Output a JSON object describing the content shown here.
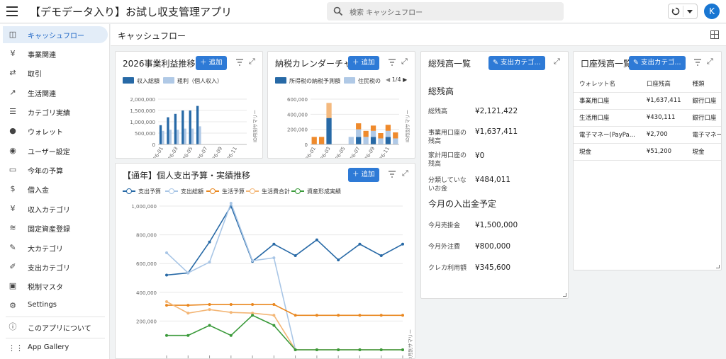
{
  "app": {
    "title": "【デモデータ入り】お試し収支管理アプリ",
    "search_placeholder": "検索 キャッシュフロー",
    "avatar_letter": "K",
    "accent": "#2e7ad6"
  },
  "sidebar": {
    "items": [
      {
        "label": "キャッシュフロー",
        "icon": "dashboard-icon",
        "active": true
      },
      {
        "label": "事業関連",
        "icon": "yen-icon"
      },
      {
        "label": "取引",
        "icon": "transfer-icon"
      },
      {
        "label": "生活関連",
        "icon": "trend-icon"
      },
      {
        "label": "カテゴリ実績",
        "icon": "list-icon"
      },
      {
        "label": "ウォレット",
        "icon": "piggy-bank-icon"
      },
      {
        "label": "ユーザー設定",
        "icon": "user-icon"
      },
      {
        "label": "今年の予算",
        "icon": "budget-icon"
      },
      {
        "label": "借入金",
        "icon": "money-bag-icon"
      },
      {
        "label": "収入カテゴリ",
        "icon": "yen-icon"
      },
      {
        "label": "固定資産登録",
        "icon": "coins-icon"
      },
      {
        "label": "大カテゴリ",
        "icon": "pen-icon"
      },
      {
        "label": "支出カテゴリ",
        "icon": "pen-outline-icon"
      },
      {
        "label": "税制マスタ",
        "icon": "banknote-icon"
      },
      {
        "label": "Settings",
        "icon": "gear-icon"
      },
      {
        "label": "このアプリについて",
        "icon": "info-icon"
      },
      {
        "label": "App Gallery",
        "icon": "apps-icon"
      }
    ]
  },
  "page": {
    "title": "キャッシュフロー"
  },
  "cards": {
    "profit": {
      "title": "2026事業利益推移予",
      "add": "追加",
      "legend": [
        "収入総額",
        "粗利（個人収入）"
      ],
      "side_label": "ID月別サマリー"
    },
    "tax": {
      "title": "納税カレンダーチャ",
      "add": "追加",
      "legend": [
        "所得税の納税予測額",
        "住民税の納"
      ],
      "pager": "1/4",
      "side_label": "ID月別サマリー"
    },
    "balance": {
      "title": "総残高一覧",
      "button": "支出カテゴ...",
      "section1": "総残高",
      "rows": [
        {
          "k": "総残高",
          "v": "¥2,121,422"
        },
        {
          "k": "事業用口座の残高",
          "v": "¥1,637,411"
        },
        {
          "k": "家計用口座の残高",
          "v": "¥0"
        },
        {
          "k": "分類していないお金",
          "v": "¥484,011"
        }
      ],
      "section2": "今月の入出金予定",
      "rows2": [
        {
          "k": "今月売掛金",
          "v": "¥1,500,000"
        },
        {
          "k": "今月外注費",
          "v": "¥800,000"
        },
        {
          "k": "クレカ利用額",
          "v": "¥345,600"
        }
      ]
    },
    "accounts": {
      "title": "口座残高一覧",
      "button": "支出カテゴ...",
      "columns": [
        "ウォレット名",
        "口座残高",
        "種類"
      ],
      "rows": [
        [
          "事業用口座",
          "¥1,637,411",
          "銀行口座"
        ],
        [
          "生活用口座",
          "¥430,111",
          "銀行口座"
        ],
        [
          "電子マネー(PayPa...",
          "¥2,700",
          "電子マネー"
        ],
        [
          "現金",
          "¥51,200",
          "現金"
        ]
      ]
    },
    "yearly": {
      "title": "【通年】個人支出予算・実績推移",
      "add": "追加",
      "side_label": "ID月別サマリー"
    }
  },
  "chart_data": [
    {
      "type": "bar",
      "title": "2026事業利益推移予",
      "categories": [
        "2026-01",
        "2026-02",
        "2026-03",
        "2026-04",
        "2026-05",
        "2026-06",
        "2026-07",
        "2026-08",
        "2026-09",
        "2026-10",
        "2026-11",
        "2026-12"
      ],
      "x_tick_labels": [
        "2026-01",
        "2026-03",
        "2026-05",
        "2026-07",
        "2026-09",
        "2026-11"
      ],
      "ylim": [
        0,
        2000000
      ],
      "y_ticks": [
        "0",
        "500,000",
        "1,000,000",
        "1,500,000",
        "2,000,000"
      ],
      "series": [
        {
          "name": "収入総額",
          "color": "#2769a6",
          "values": [
            850000,
            1200000,
            1350000,
            1500000,
            1500000,
            1700000,
            0,
            0,
            0,
            0,
            0,
            0
          ]
        },
        {
          "name": "粗利（個人収入）",
          "color": "#b0c9e6",
          "values": [
            600000,
            650000,
            650000,
            700000,
            700000,
            800000,
            0,
            0,
            0,
            0,
            0,
            0
          ]
        }
      ]
    },
    {
      "type": "bar",
      "title": "納税カレンダーチャ",
      "stacked": true,
      "categories": [
        "2026-01",
        "2026-02",
        "2026-03",
        "2026-04",
        "2026-05",
        "2026-06",
        "2026-07",
        "2026-08",
        "2026-09",
        "2026-10",
        "2026-11",
        "2026-12"
      ],
      "x_tick_labels": [
        "2026-01",
        "2026-03",
        "2026-05",
        "2026-07",
        "2026-09",
        "2026-11"
      ],
      "ylim": [
        0,
        600000
      ],
      "y_ticks": [
        "0",
        "200,000",
        "400,000",
        "600,000"
      ],
      "series": [
        {
          "name": "所得税の納税予測額",
          "color": "#2769a6",
          "values": [
            0,
            0,
            350000,
            0,
            0,
            0,
            100000,
            0,
            100000,
            0,
            100000,
            0
          ]
        },
        {
          "name": "住民税の納",
          "color": "#b0c9e6",
          "values": [
            0,
            0,
            0,
            0,
            0,
            100000,
            100000,
            100000,
            80000,
            80000,
            80000,
            80000
          ]
        },
        {
          "name": "",
          "color": "#ef8a2c",
          "values": [
            100000,
            100000,
            0,
            0,
            0,
            0,
            80000,
            80000,
            70000,
            70000,
            80000,
            80000
          ]
        },
        {
          "name": "",
          "color": "#f4b97e",
          "values": [
            0,
            0,
            200000,
            0,
            0,
            0,
            0,
            0,
            0,
            0,
            0,
            0
          ]
        }
      ]
    },
    {
      "type": "line",
      "title": "【通年】個人支出予算・実績推移",
      "ylim": [
        0,
        1000000
      ],
      "y_ticks": [
        "200,000",
        "400,000",
        "600,000",
        "800,000",
        "1,000,000"
      ],
      "series": [
        {
          "name": "支出予算",
          "color": "#2769a6",
          "values": [
            520000,
            535000,
            750000,
            1000000,
            615000,
            735000,
            655000,
            765000,
            625000,
            735000,
            655000,
            735000
          ]
        },
        {
          "name": "支出総額",
          "color": "#a9c6e6",
          "values": [
            675000,
            535000,
            610000,
            1020000,
            620000,
            640000,
            0,
            0,
            0,
            0,
            0,
            0
          ]
        },
        {
          "name": "生活予算",
          "color": "#e9871f",
          "values": [
            310000,
            310000,
            315000,
            315000,
            315000,
            315000,
            240000,
            240000,
            240000,
            240000,
            240000,
            240000
          ]
        },
        {
          "name": "生活費合計",
          "color": "#f3b676",
          "values": [
            335000,
            255000,
            280000,
            260000,
            255000,
            240000,
            0,
            0,
            0,
            0,
            0,
            0
          ]
        },
        {
          "name": "資産形成実績",
          "color": "#3a9a3a",
          "values": [
            100000,
            100000,
            170000,
            100000,
            240000,
            170000,
            0,
            0,
            0,
            0,
            0,
            0
          ]
        }
      ]
    }
  ]
}
